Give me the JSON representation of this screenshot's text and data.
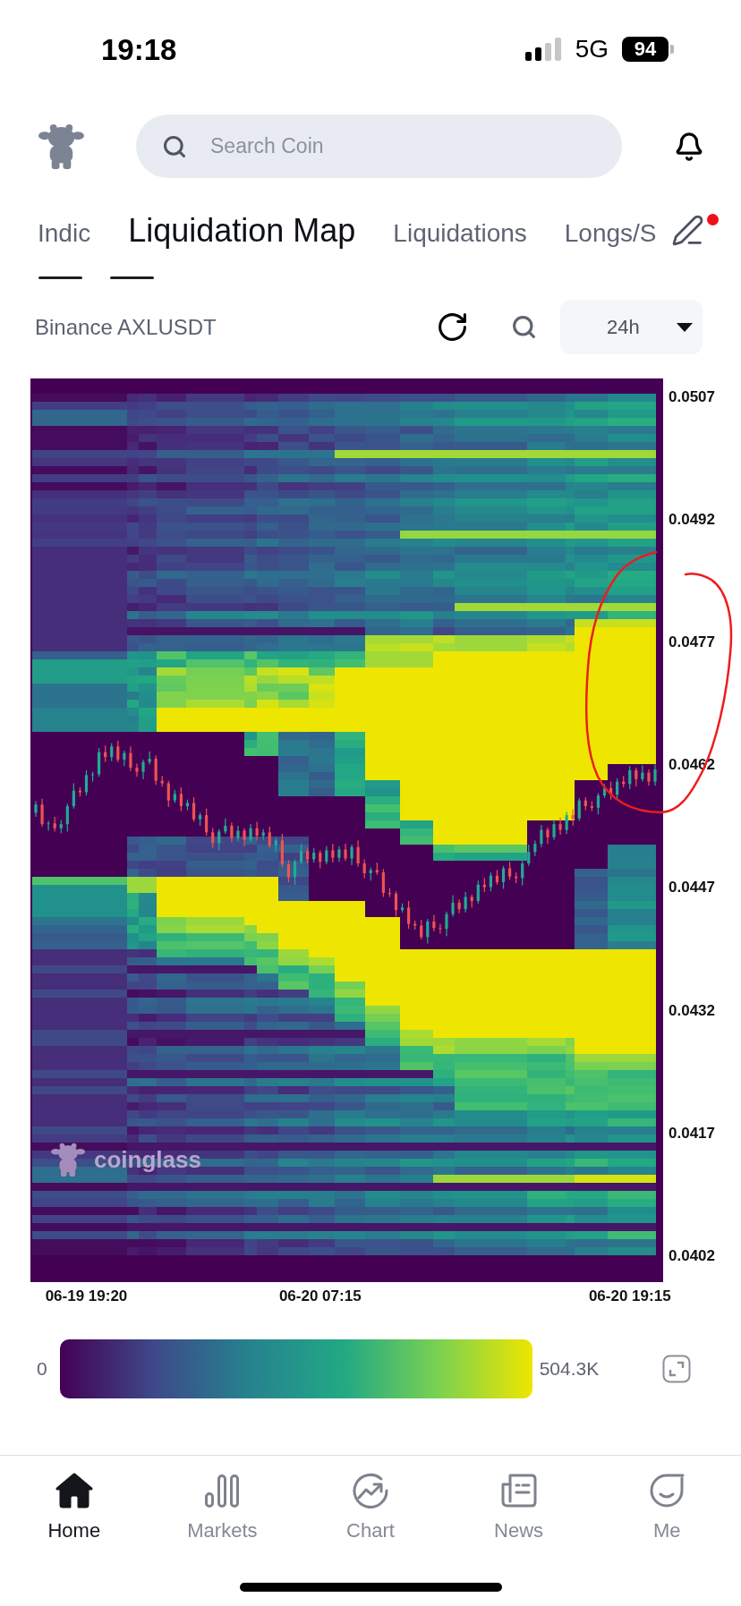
{
  "status_bar": {
    "time": "19:18",
    "network": "5G",
    "battery": "94"
  },
  "search": {
    "placeholder": "Search Coin"
  },
  "tabs": [
    {
      "label": "Indic",
      "selected": false
    },
    {
      "label": "Liquidation Map",
      "selected": true
    },
    {
      "label": "Liquidations",
      "selected": false
    },
    {
      "label": "Longs/S",
      "selected": false
    }
  ],
  "tab_edit": {
    "badge": true
  },
  "toolbar": {
    "pair": "Binance AXLUSDT",
    "range": "24h"
  },
  "chart": {
    "watermark": "coinglass",
    "chart_data": {
      "type": "candlestick",
      "ylim": [
        0.03988,
        0.05093
      ],
      "yticks": [
        {
          "value": 0.0507,
          "label": "0.0507"
        },
        {
          "value": 0.0492,
          "label": "0.0492"
        },
        {
          "value": 0.0477,
          "label": "0.0477"
        },
        {
          "value": 0.0462,
          "label": "0.0462"
        },
        {
          "value": 0.0447,
          "label": "0.0447"
        },
        {
          "value": 0.0432,
          "label": "0.0432"
        },
        {
          "value": 0.0417,
          "label": "0.0417"
        },
        {
          "value": 0.0402,
          "label": "0.0402"
        }
      ],
      "categories": [
        null,
        null,
        null,
        null,
        null,
        null,
        null,
        null,
        "06-19 19:20",
        null,
        null,
        null,
        null,
        null,
        null,
        null,
        null,
        null,
        null,
        null,
        null,
        null,
        null,
        null,
        null,
        null,
        null,
        null,
        null,
        null,
        null,
        null,
        null,
        null,
        null,
        null,
        null,
        null,
        null,
        null,
        null,
        null,
        null,
        null,
        null,
        "06-20 07:15",
        null,
        null,
        null,
        null,
        null,
        null,
        null,
        null,
        null,
        null,
        null,
        null,
        null,
        null,
        null,
        null,
        null,
        null,
        null,
        null,
        null,
        null,
        null,
        null,
        null,
        null,
        null,
        null,
        null,
        null,
        null,
        null,
        null,
        null,
        null,
        null,
        null,
        null,
        null,
        null,
        null,
        null,
        null,
        null,
        null,
        null,
        null,
        null,
        "06-20 19:15",
        null,
        null,
        null,
        null
      ],
      "ohlc": [
        [
          0.04562,
          0.04576,
          0.04557,
          0.04572
        ],
        [
          0.04572,
          0.04579,
          0.04545,
          0.04548
        ],
        [
          0.04548,
          0.04552,
          0.0454,
          0.04549
        ],
        [
          0.04549,
          0.04557,
          0.04539,
          0.04543
        ],
        [
          0.04543,
          0.04553,
          0.04537,
          0.04548
        ],
        [
          0.04548,
          0.04573,
          0.04539,
          0.0457
        ],
        [
          0.0457,
          0.04598,
          0.04567,
          0.04589
        ],
        [
          0.04589,
          0.04593,
          0.04582,
          0.04587
        ],
        [
          0.04587,
          0.04614,
          0.04583,
          0.04608
        ],
        [
          0.04608,
          0.04612,
          0.046,
          0.04609
        ],
        [
          0.04609,
          0.04641,
          0.04606,
          0.04636
        ],
        [
          0.04636,
          0.04644,
          0.04624,
          0.0463
        ],
        [
          0.0463,
          0.04647,
          0.04625,
          0.04643
        ],
        [
          0.04643,
          0.0465,
          0.04624,
          0.04627
        ],
        [
          0.04627,
          0.04638,
          0.04619,
          0.04635
        ],
        [
          0.04635,
          0.04643,
          0.04613,
          0.04617
        ],
        [
          0.04617,
          0.04622,
          0.04606,
          0.04612
        ],
        [
          0.04612,
          0.04627,
          0.04603,
          0.04624
        ],
        [
          0.04624,
          0.04637,
          0.04621,
          0.04628
        ],
        [
          0.04628,
          0.04632,
          0.04596,
          0.04601
        ],
        [
          0.04601,
          0.04607,
          0.04594,
          0.04598
        ],
        [
          0.04598,
          0.04601,
          0.04569,
          0.04577
        ],
        [
          0.04577,
          0.0459,
          0.04574,
          0.04585
        ],
        [
          0.04585,
          0.04593,
          0.04564,
          0.0457
        ],
        [
          0.0457,
          0.04578,
          0.04565,
          0.04574
        ],
        [
          0.04574,
          0.04581,
          0.04551,
          0.04554
        ],
        [
          0.04554,
          0.04562,
          0.04546,
          0.04559
        ],
        [
          0.04559,
          0.04567,
          0.04534,
          0.04538
        ],
        [
          0.04538,
          0.04543,
          0.04519,
          0.04525
        ],
        [
          0.04525,
          0.04542,
          0.04516,
          0.04539
        ],
        [
          0.04539,
          0.04555,
          0.04536,
          0.04546
        ],
        [
          0.04546,
          0.0455,
          0.04526,
          0.04531
        ],
        [
          0.04531,
          0.04546,
          0.04527,
          0.0454
        ],
        [
          0.0454,
          0.04543,
          0.04521,
          0.04529
        ],
        [
          0.04529,
          0.04548,
          0.04526,
          0.04543
        ],
        [
          0.04543,
          0.04551,
          0.04528,
          0.04534
        ],
        [
          0.04534,
          0.04542,
          0.04529,
          0.04538
        ],
        [
          0.04538,
          0.04545,
          0.04519,
          0.04522
        ],
        [
          0.04522,
          0.04531,
          0.04514,
          0.04528
        ],
        [
          0.04528,
          0.04536,
          0.04495,
          0.04499
        ],
        [
          0.04499,
          0.04504,
          0.04477,
          0.04483
        ],
        [
          0.04483,
          0.04505,
          0.04474,
          0.04502
        ],
        [
          0.04502,
          0.04524,
          0.04499,
          0.04515
        ],
        [
          0.04515,
          0.04519,
          0.045,
          0.04505
        ],
        [
          0.04505,
          0.04519,
          0.04501,
          0.04513
        ],
        [
          0.04513,
          0.04516,
          0.04494,
          0.04502
        ],
        [
          0.04502,
          0.04521,
          0.04499,
          0.04516
        ],
        [
          0.04516,
          0.04524,
          0.04501,
          0.04507
        ],
        [
          0.04507,
          0.04521,
          0.04502,
          0.04517
        ],
        [
          0.04517,
          0.04524,
          0.04503,
          0.04506
        ],
        [
          0.04506,
          0.04523,
          0.04498,
          0.0452
        ],
        [
          0.0452,
          0.04528,
          0.04496,
          0.045
        ],
        [
          0.045,
          0.04505,
          0.04482,
          0.04488
        ],
        [
          0.04488,
          0.04495,
          0.04479,
          0.04492
        ],
        [
          0.04492,
          0.04501,
          0.04486,
          0.04489
        ],
        [
          0.04489,
          0.04493,
          0.04459,
          0.04464
        ],
        [
          0.04464,
          0.0447,
          0.04459,
          0.04463
        ],
        [
          0.04463,
          0.04466,
          0.04435,
          0.04443
        ],
        [
          0.04443,
          0.04451,
          0.0444,
          0.04446
        ],
        [
          0.04446,
          0.04454,
          0.0442,
          0.04426
        ],
        [
          0.04426,
          0.0443,
          0.04419,
          0.04424
        ],
        [
          0.04424,
          0.04431,
          0.04407,
          0.0441
        ],
        [
          0.0441,
          0.04432,
          0.04402,
          0.04429
        ],
        [
          0.04429,
          0.04437,
          0.04417,
          0.04421
        ],
        [
          0.04421,
          0.04426,
          0.04414,
          0.0442
        ],
        [
          0.0442,
          0.04441,
          0.04411,
          0.04438
        ],
        [
          0.04438,
          0.04461,
          0.04435,
          0.04452
        ],
        [
          0.04452,
          0.04456,
          0.04439,
          0.04444
        ],
        [
          0.04444,
          0.04465,
          0.0444,
          0.04459
        ],
        [
          0.04459,
          0.04462,
          0.04446,
          0.04454
        ],
        [
          0.04454,
          0.04479,
          0.04451,
          0.04474
        ],
        [
          0.04474,
          0.04482,
          0.04465,
          0.04471
        ],
        [
          0.04471,
          0.04489,
          0.04466,
          0.04485
        ],
        [
          0.04485,
          0.04492,
          0.04474,
          0.04477
        ],
        [
          0.04477,
          0.04497,
          0.04469,
          0.04494
        ],
        [
          0.04494,
          0.04502,
          0.0448,
          0.04484
        ],
        [
          0.04484,
          0.04489,
          0.04476,
          0.04482
        ],
        [
          0.04482,
          0.04503,
          0.04473,
          0.045
        ],
        [
          0.045,
          0.04523,
          0.04497,
          0.04514
        ],
        [
          0.04514,
          0.04528,
          0.04509,
          0.04524
        ],
        [
          0.04524,
          0.04547,
          0.0452,
          0.04541
        ],
        [
          0.04541,
          0.04544,
          0.04524,
          0.04532
        ],
        [
          0.04532,
          0.04553,
          0.04529,
          0.04548
        ],
        [
          0.04548,
          0.04556,
          0.04535,
          0.04541
        ],
        [
          0.04541,
          0.04563,
          0.04536,
          0.04559
        ],
        [
          0.04559,
          0.04566,
          0.04546,
          0.04555
        ],
        [
          0.04555,
          0.0458,
          0.04552,
          0.04577
        ],
        [
          0.04577,
          0.04581,
          0.04565,
          0.0457
        ],
        [
          0.0457,
          0.04576,
          0.04564,
          0.04568
        ],
        [
          0.04568,
          0.04586,
          0.0456,
          0.04583
        ],
        [
          0.04583,
          0.04597,
          0.0458,
          0.04592
        ],
        [
          0.04592,
          0.046,
          0.04578,
          0.04584
        ],
        [
          0.04584,
          0.04604,
          0.04579,
          0.046
        ],
        [
          0.046,
          0.04607,
          0.04593,
          0.04597
        ],
        [
          0.04597,
          0.04619,
          0.04591,
          0.04614
        ],
        [
          0.04614,
          0.04617,
          0.04594,
          0.04603
        ],
        [
          0.04603,
          0.0462,
          0.046,
          0.04611
        ],
        [
          0.04611,
          0.04615,
          0.04595,
          0.046
        ],
        [
          0.046,
          0.04621,
          0.04595,
          0.04615
        ]
      ]
    }
  },
  "legend": {
    "min": "0",
    "max": "504.3K"
  },
  "nav": [
    {
      "label": "Home",
      "selected": true
    },
    {
      "label": "Markets",
      "selected": false
    },
    {
      "label": "Chart",
      "selected": false
    },
    {
      "label": "News",
      "selected": false
    },
    {
      "label": "Me",
      "selected": false
    }
  ]
}
